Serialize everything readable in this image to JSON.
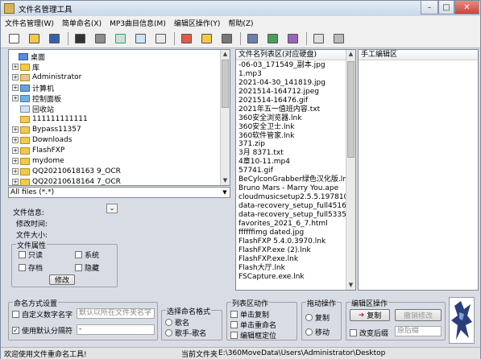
{
  "window": {
    "title": "文件名管理工具",
    "minimize": "–",
    "maximize": "□",
    "close": "✕"
  },
  "menu": [
    "文件名管理(W)",
    "简单命名(X)",
    "MP3曲目信息(M)",
    "编辑区操作(Y)",
    "帮助(Z)"
  ],
  "toolbar": [
    "new-icon",
    "open-icon",
    "save-icon",
    "copy-icon",
    "paste-icon",
    "rename-icon",
    "edit-icon",
    "undo-icon",
    "find-icon",
    "tool-icon",
    "tool2-icon",
    "tool3-icon",
    "tool4-icon",
    "tool5-icon",
    "image-icon",
    "image2-icon"
  ],
  "tree": {
    "root": "桌面",
    "items": [
      "库",
      "Administrator",
      "计算机",
      "控制面板",
      "回收站",
      "111111111111",
      "Bypass11357",
      "Downloads",
      "FlashFXP",
      "mydome",
      "QQ20210618163 9_OCR",
      "QQ20210618164 7_OCR"
    ]
  },
  "filter": {
    "value": "All files (*.*)"
  },
  "info": {
    "file_info": "文件信息:",
    "modified": "修改时间:",
    "size": "文件大小:"
  },
  "attributes": {
    "title": "文件属性",
    "readonly": "只读",
    "system": "系统",
    "archive": "存档",
    "hidden": "隐藏",
    "modify": "修改"
  },
  "filelist": {
    "header": "文件名列表区(对应硬盘)",
    "files": [
      "-06-03_171549_副本.jpg",
      "1.mp3",
      "2021-04-30_141819.jpg",
      "2021514-164712.jpeg",
      "2021514-16476.gif",
      "2021年五一值班内容.txt",
      "360安全浏览器.lnk",
      "360安全卫士.lnk",
      "360软件管家.lnk",
      "371.zip",
      "3月 8371.txt",
      "4章10-11.mp4",
      "57741.gif",
      "BeCylconGrabber绿色汉化版.lnk",
      "Bruno Mars - Marry You.ape",
      "cloudmusicsetup2.5.5.197810.exe",
      "data-recovery_setup_full4516.exe",
      "data-recovery_setup_full5335.exe",
      "favorites_2021_6_7.html",
      "ffffffimg dated.jpg",
      "FlashFXP 5.4.0.3970.lnk",
      "FlashFXP.exe (2).lnk",
      "FlashFXP.exe.lnk",
      "Flash大厅.lnk",
      "FSCapture.exe.lnk"
    ]
  },
  "edit": {
    "header": "手工编辑区"
  },
  "naming": {
    "title": "命名方式设置",
    "custom_prefix": "自定义数字名字",
    "prefix_placeholder": "默认以所在文件夹名字",
    "use_sep": "使用默认分隔符",
    "sep_value": "-"
  },
  "format": {
    "title": "选择命名格式",
    "opt1": "歌名",
    "opt2": "歌手-歌名"
  },
  "listops": {
    "title": "列表区动作",
    "op1": "单击复制",
    "op2": "单击重命名",
    "op3": "编辑框定位"
  },
  "dragop": {
    "title": "拖动操作",
    "copy": "复制",
    "move": "移动"
  },
  "editops": {
    "title": "编辑区操作",
    "copy_btn": "复制",
    "undo_btn": "撤销修改",
    "change_suffix": "改变后缀",
    "suffix_placeholder": "原后缀"
  },
  "status": {
    "left": "欢迎使用文件重命名工具!",
    "cur_label": "当前文件夹",
    "path": "E:\\360MoveData\\Users\\Administrator\\Desktop"
  }
}
